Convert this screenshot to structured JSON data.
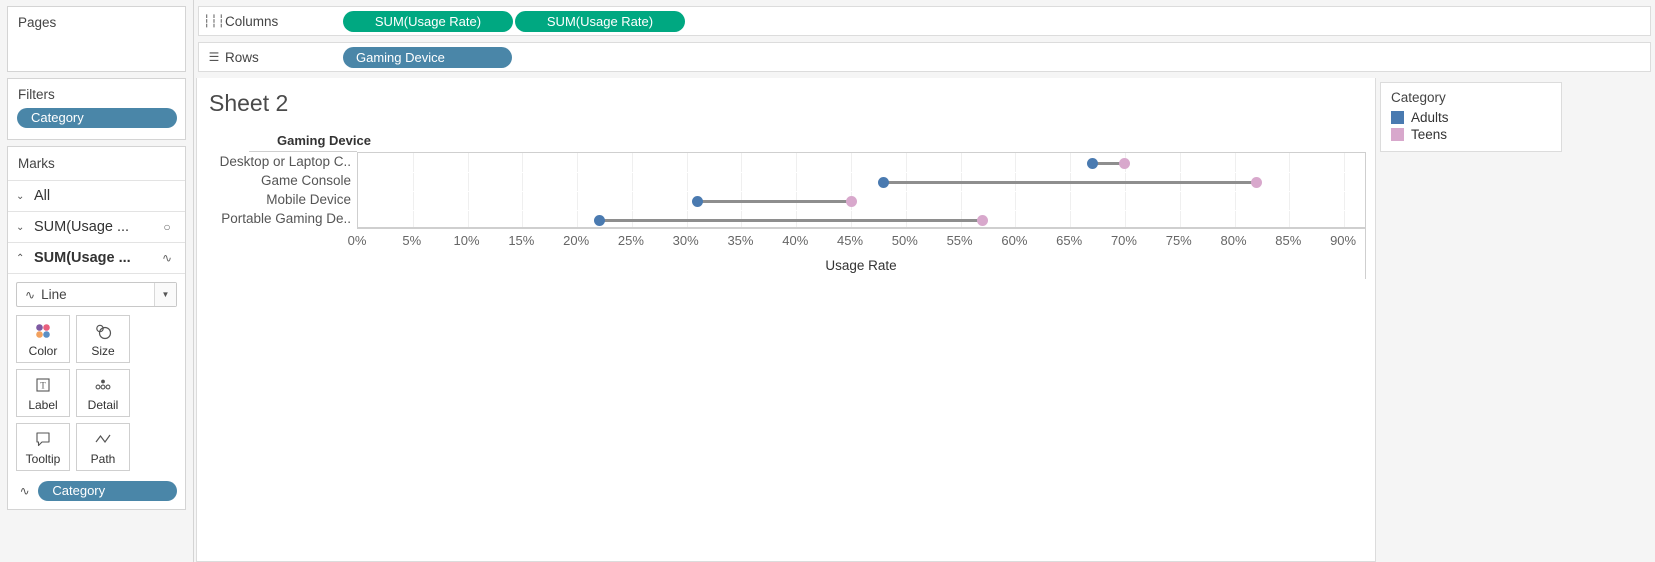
{
  "left_panel": {
    "pages": {
      "title": "Pages"
    },
    "filters": {
      "title": "Filters",
      "pill": "Category"
    },
    "marks": {
      "title": "Marks",
      "rows": [
        {
          "label": "All",
          "glyph": "",
          "chevron": "⌄"
        },
        {
          "label": "SUM(Usage ...",
          "glyph": "○",
          "chevron": "⌄"
        },
        {
          "label": "SUM(Usage ...",
          "glyph": "∿",
          "chevron": "⌃"
        }
      ],
      "mark_type": "Line",
      "mark_type_icon": "∿",
      "buttons": [
        {
          "label": "Color",
          "icon": "color-dots-icon"
        },
        {
          "label": "Size",
          "icon": "size-circles-icon"
        },
        {
          "label": "Label",
          "icon": "label-t-icon"
        },
        {
          "label": "Detail",
          "icon": "detail-dots-icon"
        },
        {
          "label": "Tooltip",
          "icon": "tooltip-bubble-icon"
        },
        {
          "label": "Path",
          "icon": "path-line-icon"
        }
      ],
      "encoding": {
        "glyph": "∿",
        "pill": "Category"
      }
    }
  },
  "shelves": {
    "columns": {
      "label": "Columns",
      "icon": "columns-icon",
      "pills": [
        "SUM(Usage Rate)",
        "SUM(Usage Rate)"
      ]
    },
    "rows": {
      "label": "Rows",
      "icon": "rows-icon",
      "pills": [
        "Gaming Device"
      ]
    }
  },
  "view": {
    "sheet_title": "Sheet 2",
    "field_caption": "Gaming Device"
  },
  "legend": {
    "title": "Category",
    "items": [
      {
        "label": "Adults",
        "color": "#4a7ab0"
      },
      {
        "label": "Teens",
        "color": "#d8a8cc"
      }
    ]
  },
  "chart_data": {
    "type": "bar",
    "subtype": "dumbbell",
    "title": "Sheet 2",
    "xlabel": "Usage Rate",
    "ylabel": "Gaming Device",
    "xlim": [
      0,
      92
    ],
    "xtick_step": 5,
    "xticks": [
      "0%",
      "5%",
      "10%",
      "15%",
      "20%",
      "25%",
      "30%",
      "35%",
      "40%",
      "45%",
      "50%",
      "55%",
      "60%",
      "65%",
      "70%",
      "75%",
      "80%",
      "85%",
      "90%"
    ],
    "grid": true,
    "legend_position": "right",
    "categories": [
      "Desktop or Laptop C..",
      "Game Console",
      "Mobile Device",
      "Portable Gaming De.."
    ],
    "categories_full": [
      "Desktop or Laptop Computer",
      "Game Console",
      "Mobile Device",
      "Portable Gaming Device"
    ],
    "series": [
      {
        "name": "Adults",
        "color": "#4a7ab0",
        "values": [
          67,
          48,
          31,
          22
        ]
      },
      {
        "name": "Teens",
        "color": "#d8a8cc",
        "values": [
          70,
          82,
          45,
          57
        ]
      }
    ],
    "connector_color": "#8e8e8e"
  }
}
